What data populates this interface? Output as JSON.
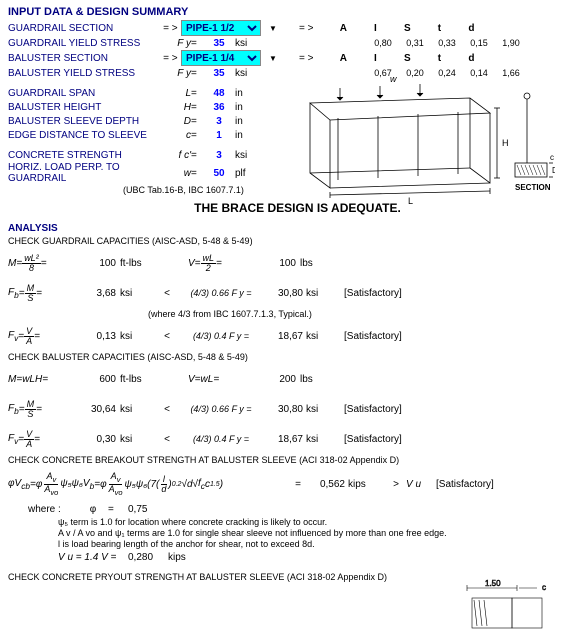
{
  "header": "INPUT DATA & DESIGN SUMMARY",
  "inputs": {
    "guardrail_section": {
      "label": "GUARDRAIL SECTION",
      "select": "PIPE-1 1/2",
      "cols_label": [
        "A",
        "I",
        "S",
        "t",
        "d"
      ],
      "cols_val": [
        "0,80",
        "0,31",
        "0,33",
        "0,15",
        "1,90"
      ]
    },
    "guardrail_yield": {
      "label": "GUARDRAIL YIELD STRESS",
      "sym": "F y",
      "val": "35",
      "unit": "ksi"
    },
    "baluster_section": {
      "label": "BALUSTER SECTION",
      "select": "PIPE-1 1/4",
      "cols_label": [
        "A",
        "I",
        "S",
        "t",
        "d"
      ],
      "cols_val": [
        "0,67",
        "0,20",
        "0,24",
        "0,14",
        "1,66"
      ]
    },
    "baluster_yield": {
      "label": "BALUSTER YIELD STRESS",
      "sym": "F y",
      "val": "35",
      "unit": "ksi"
    },
    "span": {
      "label": "GUARDRAIL SPAN",
      "sym": "L",
      "val": "48",
      "unit": "in"
    },
    "height": {
      "label": "BALUSTER HEIGHT",
      "sym": "H",
      "val": "36",
      "unit": "in"
    },
    "sleeve_depth": {
      "label": "BALUSTER SLEEVE DEPTH",
      "sym": "D",
      "val": "3",
      "unit": "in"
    },
    "edge_dist": {
      "label": "EDGE DISTANCE TO SLEEVE",
      "sym": "c",
      "val": "1",
      "unit": "in"
    },
    "concrete": {
      "label": "CONCRETE STRENGTH",
      "sym": "f c'",
      "val": "3",
      "unit": "ksi"
    },
    "horiz_load": {
      "label": "HORIZ. LOAD PERP. TO GUARDRAIL",
      "sym": "w",
      "val": "50",
      "unit": "plf"
    }
  },
  "ubc_note": "(UBC Tab.16-B, IBC 1607.7.1)",
  "adequate": "THE BRACE DESIGN IS ADEQUATE.",
  "analysis_header": "ANALYSIS",
  "checks": {
    "guardrail_title": "CHECK GUARDRAIL CAPACITIES (AISC-ASD, 5-48 & 5-49)",
    "baluster_title": "CHECK BALUSTER CAPACITIES (AISC-ASD, 5-48 & 5-49)",
    "breakout_title": "CHECK CONCRETE BREAKOUT STRENGTH AT BALUSTER SLEEVE (ACI 318-02 Appendix D)",
    "pryout_title": "CHECK CONCRETE PRYOUT STRENGTH AT BALUSTER SLEEVE (ACI 318-02 Appendix D)",
    "g_M": {
      "val": "100",
      "unit": "ft-lbs"
    },
    "g_V": {
      "val": "100",
      "unit": "lbs"
    },
    "g_Fb": {
      "val": "3,68",
      "unit": "ksi",
      "mid": "(4/3) 0.66 F y",
      "val2": "30,80",
      "unit2": "ksi",
      "sat": "[Satisfactory]"
    },
    "g_Fv": {
      "val": "0,13",
      "unit": "ksi",
      "mid": "(4/3) 0.4 F y",
      "val2": "18,67",
      "unit2": "ksi",
      "sat": "[Satisfactory]"
    },
    "b_M": {
      "val": "600",
      "unit": "ft-lbs"
    },
    "b_V": {
      "val": "200",
      "unit": "lbs"
    },
    "b_Fb": {
      "val": "30,64",
      "unit": "ksi",
      "mid": "(4/3) 0.66 F y",
      "val2": "30,80",
      "unit2": "ksi",
      "sat": "[Satisfactory]"
    },
    "b_Fv": {
      "val": "0,30",
      "unit": "ksi",
      "mid": "(4/3) 0.4 F y",
      "val2": "18,67",
      "unit2": "ksi",
      "sat": "[Satisfactory]"
    },
    "note43": "(where 4/3 from IBC 1607.7.1.3, Typical.)",
    "breakout": {
      "val": "0,562",
      "unit": "kips",
      "gt": ">",
      "vu": "V u",
      "sat": "[Satisfactory]"
    },
    "where_label": "where :",
    "phi_label": "φ",
    "phi_val": "0,75",
    "psi5": "ψ₅ term is 1.0 for location where concrete cracking is likely to occur.",
    "av_terms": "A v / A vo  and ψ₁ terms are 1.0 for single shear sleeve not influenced by more than one free edge.",
    "l_note": "l is load bearing length of the anchor for shear, not to exceed 8d.",
    "vu_eq": "V u = 1.4 V =",
    "vu_val": "0,280",
    "vu_unit": "kips"
  },
  "diagram": {
    "w": "w",
    "H": "H",
    "L": "L",
    "D": "D",
    "c": "c",
    "section": "SECTION",
    "dim": "1.50"
  }
}
